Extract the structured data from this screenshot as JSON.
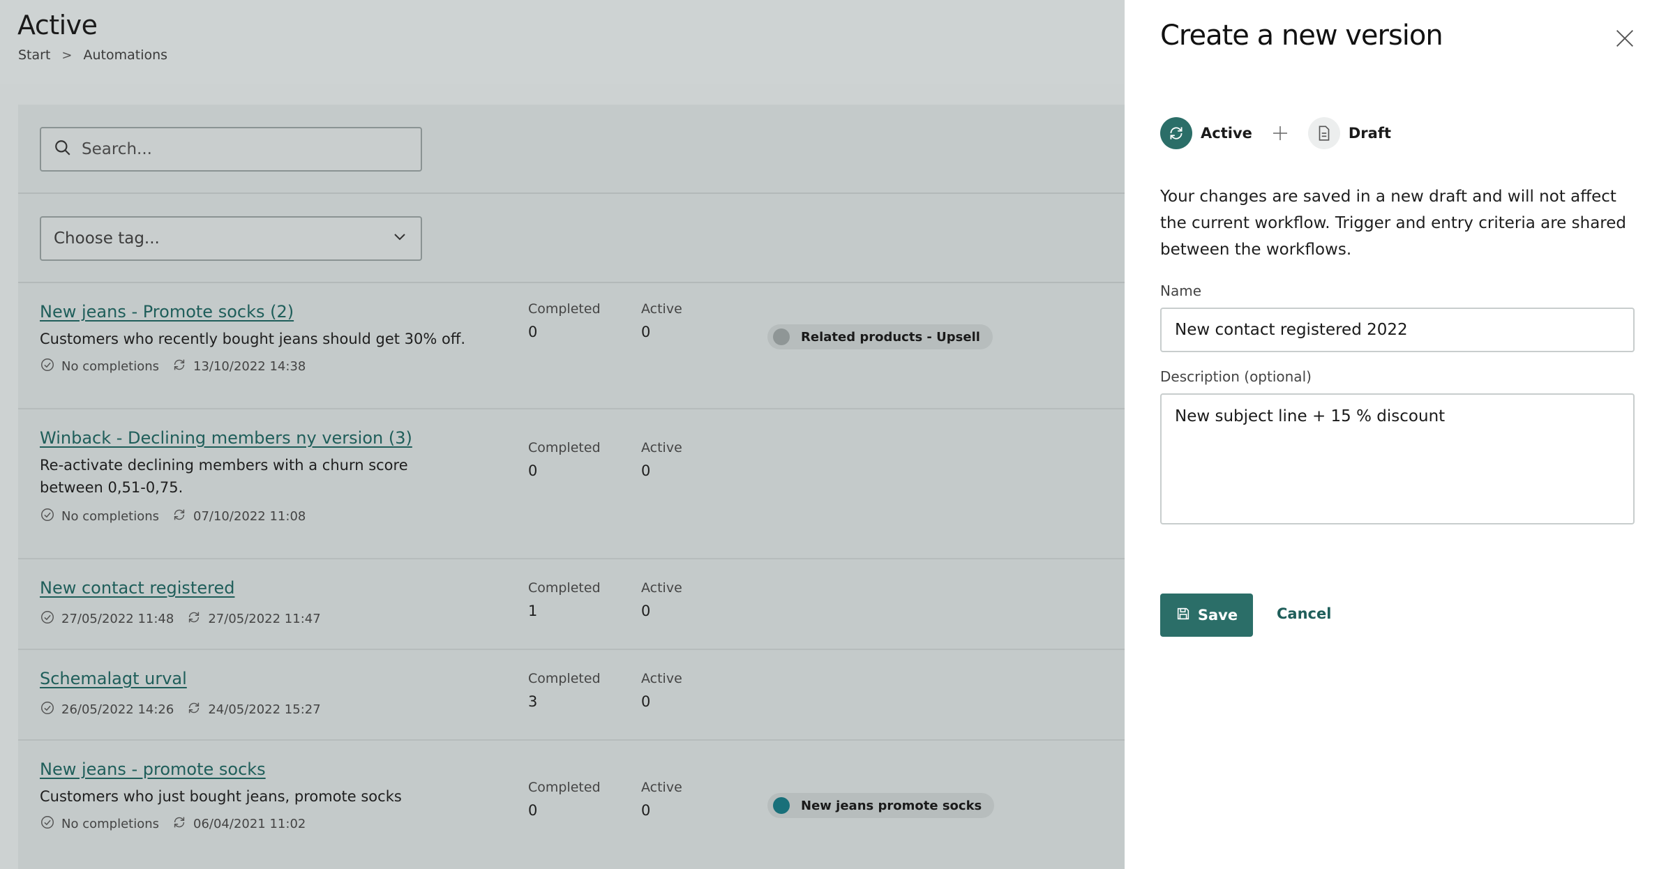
{
  "page": {
    "title": "Active",
    "breadcrumb": [
      "Start",
      "Automations"
    ],
    "breadcrumb_separator": ">"
  },
  "filters": {
    "search_placeholder": "Search...",
    "tag_placeholder": "Choose tag..."
  },
  "stat_labels": {
    "completed": "Completed",
    "active": "Active"
  },
  "rows": [
    {
      "title": "New jeans - Promote socks (2)",
      "description": "Customers who recently bought jeans should get 30% off.",
      "completion": "No completions",
      "updated": "13/10/2022 14:38",
      "completed": "0",
      "active": "0",
      "tag": "Related products - Upsell",
      "tag_color": "#8f9696"
    },
    {
      "title": "Winback - Declining members ny version (3)",
      "description": "Re-activate declining members with a churn score between 0,51-0,75.",
      "completion": "No completions",
      "updated": "07/10/2022 11:08",
      "completed": "0",
      "active": "0"
    },
    {
      "title": "New contact registered",
      "completion": "27/05/2022 11:48",
      "updated": "27/05/2022 11:47",
      "completed": "1",
      "active": "0"
    },
    {
      "title": "Schemalagt urval",
      "completion": "26/05/2022 14:26",
      "updated": "24/05/2022 15:27",
      "completed": "3",
      "active": "0"
    },
    {
      "title": "New jeans - promote socks",
      "description": "Customers who just bought jeans, promote socks",
      "completion": "No completions",
      "updated": "06/04/2021 11:02",
      "completed": "0",
      "active": "0",
      "tag": "New jeans promote socks",
      "tag_color": "#19707a"
    }
  ],
  "drawer": {
    "title": "Create a new version",
    "version_from": "Active",
    "version_to": "Draft",
    "info": "Your changes are saved in a new draft and will not affect the current workflow. Trigger and entry criteria are shared between the workflows.",
    "name_label": "Name",
    "name_value": "New contact registered 2022",
    "description_label": "Description (optional)",
    "description_value": "New subject line + 15 % discount",
    "save_label": "Save",
    "cancel_label": "Cancel"
  },
  "colors": {
    "accent": "#2b6e68",
    "link": "#1f5e5a",
    "overlay_bg": "#cdd2d2"
  }
}
